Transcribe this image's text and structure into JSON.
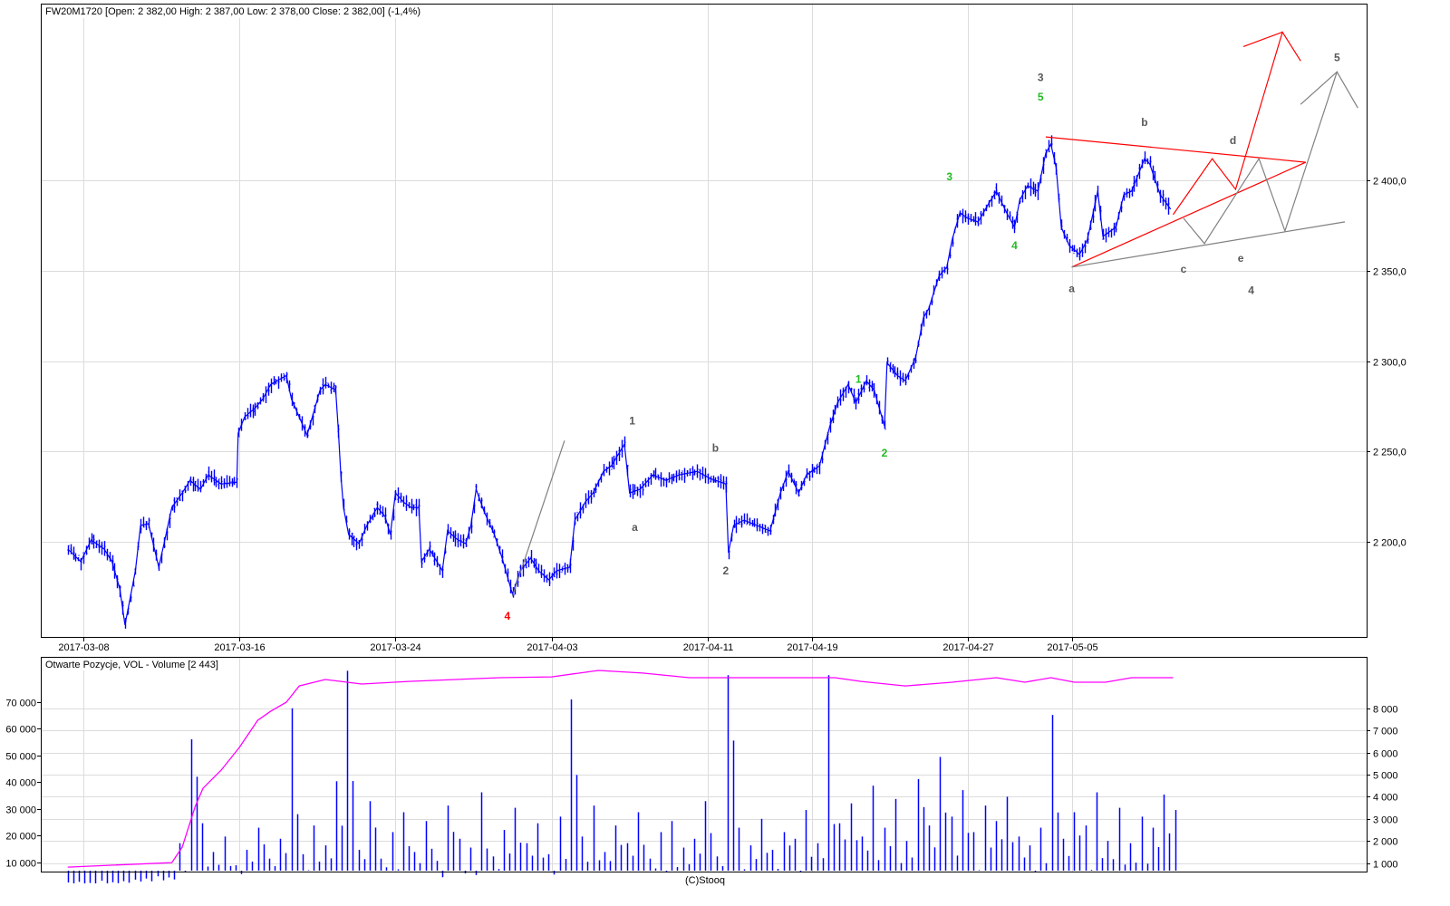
{
  "header": {
    "title": "FW20M1720 [Open: 2 382,00  High: 2 387,00  Low: 2 378,00  Close: 2 382,00] (-1,4%)"
  },
  "volume_panel": {
    "title": "Otwarte Pozycje, VOL - Volume [2 443]"
  },
  "footer": {
    "credit": "(C)Stooq"
  },
  "colors": {
    "price": "#0000ff",
    "volume": "#0000ff",
    "open_interest": "#ff00ff",
    "grid": "#dcdcdc",
    "wave_gray": "#595959",
    "wave_green": "#22bb22",
    "wave_red": "#ff0000"
  },
  "chart_data": [
    {
      "type": "line",
      "title": "FW20M1720",
      "x_unit": "trading days since 2017-03-08",
      "x_ticks": [
        {
          "day": 0,
          "label": "2017-03-08"
        },
        {
          "day": 6,
          "label": "2017-03-16"
        },
        {
          "day": 12,
          "label": "2017-03-24"
        },
        {
          "day": 18,
          "label": "2017-04-03"
        },
        {
          "day": 24,
          "label": "2017-04-11"
        },
        {
          "day": 28,
          "label": "2017-04-19"
        },
        {
          "day": 34,
          "label": "2017-04-27"
        },
        {
          "day": 38,
          "label": "2017-05-05"
        }
      ],
      "y_ticks": [
        {
          "value": 2200,
          "label": "2 200,0"
        },
        {
          "value": 2250,
          "label": "2 250,0"
        },
        {
          "value": 2300,
          "label": "2 300,0"
        },
        {
          "value": 2350,
          "label": "2 350,0"
        },
        {
          "value": 2400,
          "label": "2 400,0"
        }
      ],
      "ylim": [
        2150,
        2500
      ],
      "price": [
        [
          -0.6,
          2196
        ],
        [
          -0.1,
          2189
        ],
        [
          0.3,
          2201
        ],
        [
          0.8,
          2196
        ],
        [
          1.1,
          2189
        ],
        [
          1.4,
          2174
        ],
        [
          1.6,
          2154
        ],
        [
          1.8,
          2169
        ],
        [
          2.0,
          2184
        ],
        [
          2.2,
          2209
        ],
        [
          2.5,
          2210
        ],
        [
          2.9,
          2186
        ],
        [
          3.1,
          2199
        ],
        [
          3.4,
          2219
        ],
        [
          3.8,
          2227
        ],
        [
          4.1,
          2234
        ],
        [
          4.5,
          2229
        ],
        [
          4.8,
          2237
        ],
        [
          5.3,
          2232
        ],
        [
          5.9,
          2233
        ],
        [
          5.95,
          2260
        ],
        [
          6.2,
          2269
        ],
        [
          6.6,
          2274
        ],
        [
          6.9,
          2279
        ],
        [
          7.2,
          2287
        ],
        [
          7.8,
          2292
        ],
        [
          8.0,
          2279
        ],
        [
          8.3,
          2269
        ],
        [
          8.6,
          2259
        ],
        [
          8.8,
          2269
        ],
        [
          9.1,
          2284
        ],
        [
          9.3,
          2287
        ],
        [
          9.7,
          2284
        ],
        [
          9.8,
          2262
        ],
        [
          9.9,
          2237
        ],
        [
          10.0,
          2219
        ],
        [
          10.2,
          2204
        ],
        [
          10.6,
          2199
        ],
        [
          10.9,
          2209
        ],
        [
          11.3,
          2219
        ],
        [
          11.6,
          2214
        ],
        [
          11.8,
          2204
        ],
        [
          12.0,
          2227
        ],
        [
          12.3,
          2222
        ],
        [
          12.6,
          2219
        ],
        [
          12.9,
          2219
        ],
        [
          13.0,
          2189
        ],
        [
          13.3,
          2196
        ],
        [
          13.8,
          2184
        ],
        [
          14.0,
          2206
        ],
        [
          14.4,
          2201
        ],
        [
          14.7,
          2199
        ],
        [
          14.9,
          2209
        ],
        [
          15.1,
          2229
        ],
        [
          15.4,
          2217
        ],
        [
          15.8,
          2204
        ],
        [
          16.1,
          2191
        ],
        [
          16.5,
          2171
        ],
        [
          16.8,
          2184
        ],
        [
          17.2,
          2191
        ],
        [
          17.5,
          2184
        ],
        [
          17.9,
          2179
        ],
        [
          18.2,
          2184
        ],
        [
          18.7,
          2186
        ],
        [
          18.9,
          2212
        ],
        [
          19.3,
          2222
        ],
        [
          19.6,
          2227
        ],
        [
          20.0,
          2239
        ],
        [
          20.3,
          2242
        ],
        [
          20.8,
          2254
        ],
        [
          21.0,
          2227
        ],
        [
          21.4,
          2229
        ],
        [
          21.9,
          2237
        ],
        [
          22.4,
          2234
        ],
        [
          22.9,
          2237
        ],
        [
          23.6,
          2239
        ],
        [
          24.1,
          2235
        ],
        [
          24.7,
          2232
        ],
        [
          24.8,
          2194
        ],
        [
          25.0,
          2209
        ],
        [
          25.4,
          2212
        ],
        [
          25.9,
          2209
        ],
        [
          26.4,
          2206
        ],
        [
          26.8,
          2227
        ],
        [
          27.1,
          2239
        ],
        [
          27.5,
          2227
        ],
        [
          27.8,
          2237
        ],
        [
          28.3,
          2242
        ],
        [
          28.7,
          2264
        ],
        [
          29.0,
          2277
        ],
        [
          29.4,
          2287
        ],
        [
          29.7,
          2277
        ],
        [
          30.1,
          2289
        ],
        [
          30.4,
          2284
        ],
        [
          30.8,
          2264
        ],
        [
          30.9,
          2299
        ],
        [
          31.3,
          2292
        ],
        [
          31.6,
          2289
        ],
        [
          32.0,
          2302
        ],
        [
          32.3,
          2324
        ],
        [
          32.5,
          2329
        ],
        [
          32.9,
          2347
        ],
        [
          33.2,
          2352
        ],
        [
          33.4,
          2367
        ],
        [
          33.7,
          2382
        ],
        [
          34.0,
          2379
        ],
        [
          34.4,
          2377
        ],
        [
          34.8,
          2387
        ],
        [
          35.1,
          2394
        ],
        [
          35.5,
          2382
        ],
        [
          35.8,
          2374
        ],
        [
          36.0,
          2389
        ],
        [
          36.3,
          2397
        ],
        [
          36.7,
          2394
        ],
        [
          37.0,
          2415
        ],
        [
          37.2,
          2420
        ],
        [
          37.4,
          2407
        ],
        [
          37.6,
          2374
        ],
        [
          37.9,
          2364
        ],
        [
          38.3,
          2359
        ],
        [
          38.6,
          2367
        ],
        [
          39.0,
          2394
        ],
        [
          39.2,
          2369
        ],
        [
          39.7,
          2374
        ],
        [
          40.0,
          2392
        ],
        [
          40.3,
          2394
        ],
        [
          40.8,
          2412
        ],
        [
          41.0,
          2409
        ],
        [
          41.4,
          2392
        ],
        [
          41.8,
          2384
        ]
      ],
      "annotations": [
        {
          "day": 21.1,
          "price": 2267,
          "text": "1",
          "color": "gray"
        },
        {
          "day": 21.2,
          "price": 2208,
          "text": "a",
          "color": "gray"
        },
        {
          "day": 24.3,
          "price": 2252,
          "text": "b",
          "color": "gray"
        },
        {
          "day": 24.7,
          "price": 2184,
          "text": "2",
          "color": "gray"
        },
        {
          "day": 36.8,
          "price": 2457,
          "text": "3",
          "color": "gray"
        },
        {
          "day": 40.8,
          "price": 2432,
          "text": "b",
          "color": "gray"
        },
        {
          "day": 44.2,
          "price": 2422,
          "text": "d",
          "color": "gray"
        },
        {
          "day": 42.3,
          "price": 2351,
          "text": "c",
          "color": "gray"
        },
        {
          "day": 44.5,
          "price": 2357,
          "text": "e",
          "color": "gray"
        },
        {
          "day": 38.0,
          "price": 2340,
          "text": "a",
          "color": "gray"
        },
        {
          "day": 44.9,
          "price": 2339,
          "text": "4",
          "color": "gray"
        },
        {
          "day": 48.2,
          "price": 2468,
          "text": "5",
          "color": "gray"
        },
        {
          "day": 29.8,
          "price": 2290,
          "text": "1",
          "color": "green"
        },
        {
          "day": 30.8,
          "price": 2249,
          "text": "2",
          "color": "green"
        },
        {
          "day": 33.3,
          "price": 2402,
          "text": "3",
          "color": "green"
        },
        {
          "day": 35.8,
          "price": 2364,
          "text": "4",
          "color": "green"
        },
        {
          "day": 36.8,
          "price": 2446,
          "text": "5",
          "color": "green"
        },
        {
          "day": 16.3,
          "price": 2159,
          "text": "4",
          "color": "red"
        }
      ],
      "trend_lines": [
        {
          "color": "gray",
          "points": [
            [
              16.5,
              2170
            ],
            [
              18.5,
              2256
            ]
          ]
        },
        {
          "color": "red",
          "points": [
            [
              37.0,
              2424
            ],
            [
              47.0,
              2410
            ]
          ]
        },
        {
          "color": "red",
          "points": [
            [
              38.0,
              2352
            ],
            [
              47.0,
              2410
            ]
          ]
        },
        {
          "color": "gray",
          "points": [
            [
              38.0,
              2352
            ],
            [
              48.5,
              2377
            ]
          ]
        },
        {
          "color": "red",
          "points": [
            [
              41.9,
              2381
            ],
            [
              43.4,
              2412
            ],
            [
              44.3,
              2395
            ],
            [
              46.1,
              2482
            ],
            [
              46.8,
              2466
            ]
          ]
        },
        {
          "color": "red",
          "points": [
            [
              44.6,
              2474
            ],
            [
              46.1,
              2482
            ]
          ]
        },
        {
          "color": "gray",
          "points": [
            [
              42.3,
              2379
            ],
            [
              43.1,
              2365
            ],
            [
              45.2,
              2412
            ],
            [
              46.2,
              2372
            ],
            [
              48.2,
              2460
            ],
            [
              49.0,
              2440
            ]
          ]
        },
        {
          "color": "gray",
          "points": [
            [
              46.8,
              2442
            ],
            [
              48.2,
              2460
            ]
          ]
        }
      ]
    },
    {
      "type": "bar",
      "title": "Otwarte Pozycje, VOL - Volume [2 443]",
      "volume_ticks": [
        {
          "value": 1000,
          "label": "1 000"
        },
        {
          "value": 2000,
          "label": "2 000"
        },
        {
          "value": 3000,
          "label": "3 000"
        },
        {
          "value": 4000,
          "label": "4 000"
        },
        {
          "value": 5000,
          "label": "5 000"
        },
        {
          "value": 6000,
          "label": "6 000"
        },
        {
          "value": 7000,
          "label": "7 000"
        },
        {
          "value": 8000,
          "label": "8 000"
        }
      ],
      "oi_ticks": [
        {
          "value": 10000,
          "label": "10 000"
        },
        {
          "value": 20000,
          "label": "20 000"
        },
        {
          "value": 30000,
          "label": "30 000"
        },
        {
          "value": 40000,
          "label": "40 000"
        },
        {
          "value": 50000,
          "label": "50 000"
        },
        {
          "value": 60000,
          "label": "60 000"
        },
        {
          "value": 70000,
          "label": "70 000"
        }
      ],
      "volume_start_day": -0.6,
      "volume_step_day": 0.43,
      "volume": [
        120,
        150,
        100,
        200,
        130,
        180,
        250,
        300,
        400,
        350,
        1900,
        6600,
        2800,
        1500,
        2200,
        900,
        1600,
        2600,
        1200,
        2100,
        8000,
        1400,
        2700,
        1800,
        4700,
        9700,
        1600,
        3800,
        1200,
        2400,
        3300,
        1500,
        2900,
        1100,
        3600,
        2100,
        1700,
        4200,
        1300,
        2500,
        3500,
        1900,
        2800,
        1400,
        3100,
        8400,
        2200,
        3600,
        1500,
        2700,
        1900,
        3300,
        1200,
        2400,
        2900,
        1700,
        2100,
        3800,
        1300,
        9500,
        2600,
        1800,
        3000,
        1600,
        2400,
        2100,
        3400,
        1900,
        9500,
        2800,
        3700,
        2200,
        4500,
        2600,
        3900,
        2000,
        4800,
        2700,
        5800,
        3100,
        4300,
        2400,
        3600,
        2900,
        4000,
        2200,
        1800,
        2600,
        7700,
        2100,
        3300,
        2700,
        4200,
        2000,
        3500,
        1900,
        3100,
        2600,
        4100,
        3400
      ],
      "open_interest": [
        [
          -0.6,
          8100
        ],
        [
          3.4,
          9800
        ],
        [
          3.8,
          15600
        ],
        [
          4.3,
          30800
        ],
        [
          4.6,
          37600
        ],
        [
          5.3,
          44400
        ],
        [
          6.0,
          52900
        ],
        [
          6.7,
          63000
        ],
        [
          7.2,
          66400
        ],
        [
          7.8,
          69800
        ],
        [
          8.3,
          75900
        ],
        [
          9.3,
          78300
        ],
        [
          10.7,
          76600
        ],
        [
          12.5,
          77600
        ],
        [
          16.0,
          79000
        ],
        [
          18.0,
          79300
        ],
        [
          19.8,
          81700
        ],
        [
          21.5,
          80700
        ],
        [
          23.3,
          79000
        ],
        [
          26.4,
          79000
        ],
        [
          28.9,
          79000
        ],
        [
          29.9,
          77600
        ],
        [
          31.6,
          75900
        ],
        [
          33.4,
          77300
        ],
        [
          35.1,
          79000
        ],
        [
          36.2,
          77300
        ],
        [
          37.2,
          79000
        ],
        [
          38.1,
          77300
        ],
        [
          39.3,
          77300
        ],
        [
          40.3,
          79000
        ],
        [
          41.9,
          79000
        ]
      ]
    }
  ]
}
